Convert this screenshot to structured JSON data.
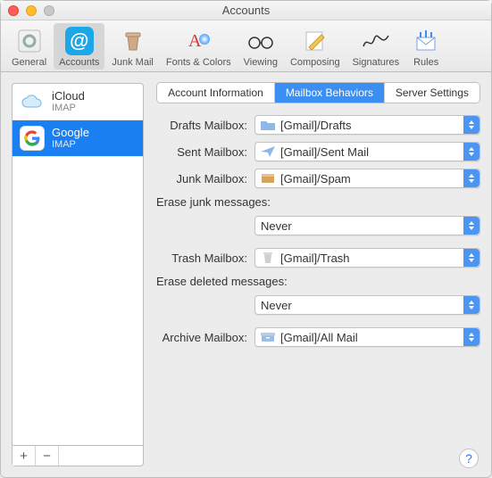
{
  "window": {
    "title": "Accounts"
  },
  "toolbar": {
    "items": [
      {
        "label": "General"
      },
      {
        "label": "Accounts"
      },
      {
        "label": "Junk Mail"
      },
      {
        "label": "Fonts & Colors"
      },
      {
        "label": "Viewing"
      },
      {
        "label": "Composing"
      },
      {
        "label": "Signatures"
      },
      {
        "label": "Rules"
      }
    ],
    "selectedIndex": 1
  },
  "accountsList": {
    "items": [
      {
        "name": "iCloud",
        "type": "IMAP"
      },
      {
        "name": "Google",
        "type": "IMAP"
      }
    ],
    "selectedIndex": 1,
    "addLabel": "+",
    "removeLabel": "−"
  },
  "tabs": {
    "items": [
      {
        "label": "Account Information"
      },
      {
        "label": "Mailbox Behaviors"
      },
      {
        "label": "Server Settings"
      }
    ],
    "selectedIndex": 1
  },
  "mailboxBehaviors": {
    "drafts": {
      "label": "Drafts Mailbox:",
      "value": "[Gmail]/Drafts"
    },
    "sent": {
      "label": "Sent Mailbox:",
      "value": "[Gmail]/Sent Mail"
    },
    "junk": {
      "label": "Junk Mailbox:",
      "value": "[Gmail]/Spam",
      "eraseLabel": "Erase junk messages:",
      "eraseValue": "Never"
    },
    "trash": {
      "label": "Trash Mailbox:",
      "value": "[Gmail]/Trash",
      "eraseLabel": "Erase deleted messages:",
      "eraseValue": "Never"
    },
    "archive": {
      "label": "Archive Mailbox:",
      "value": "[Gmail]/All Mail"
    }
  },
  "help": {
    "label": "?"
  }
}
